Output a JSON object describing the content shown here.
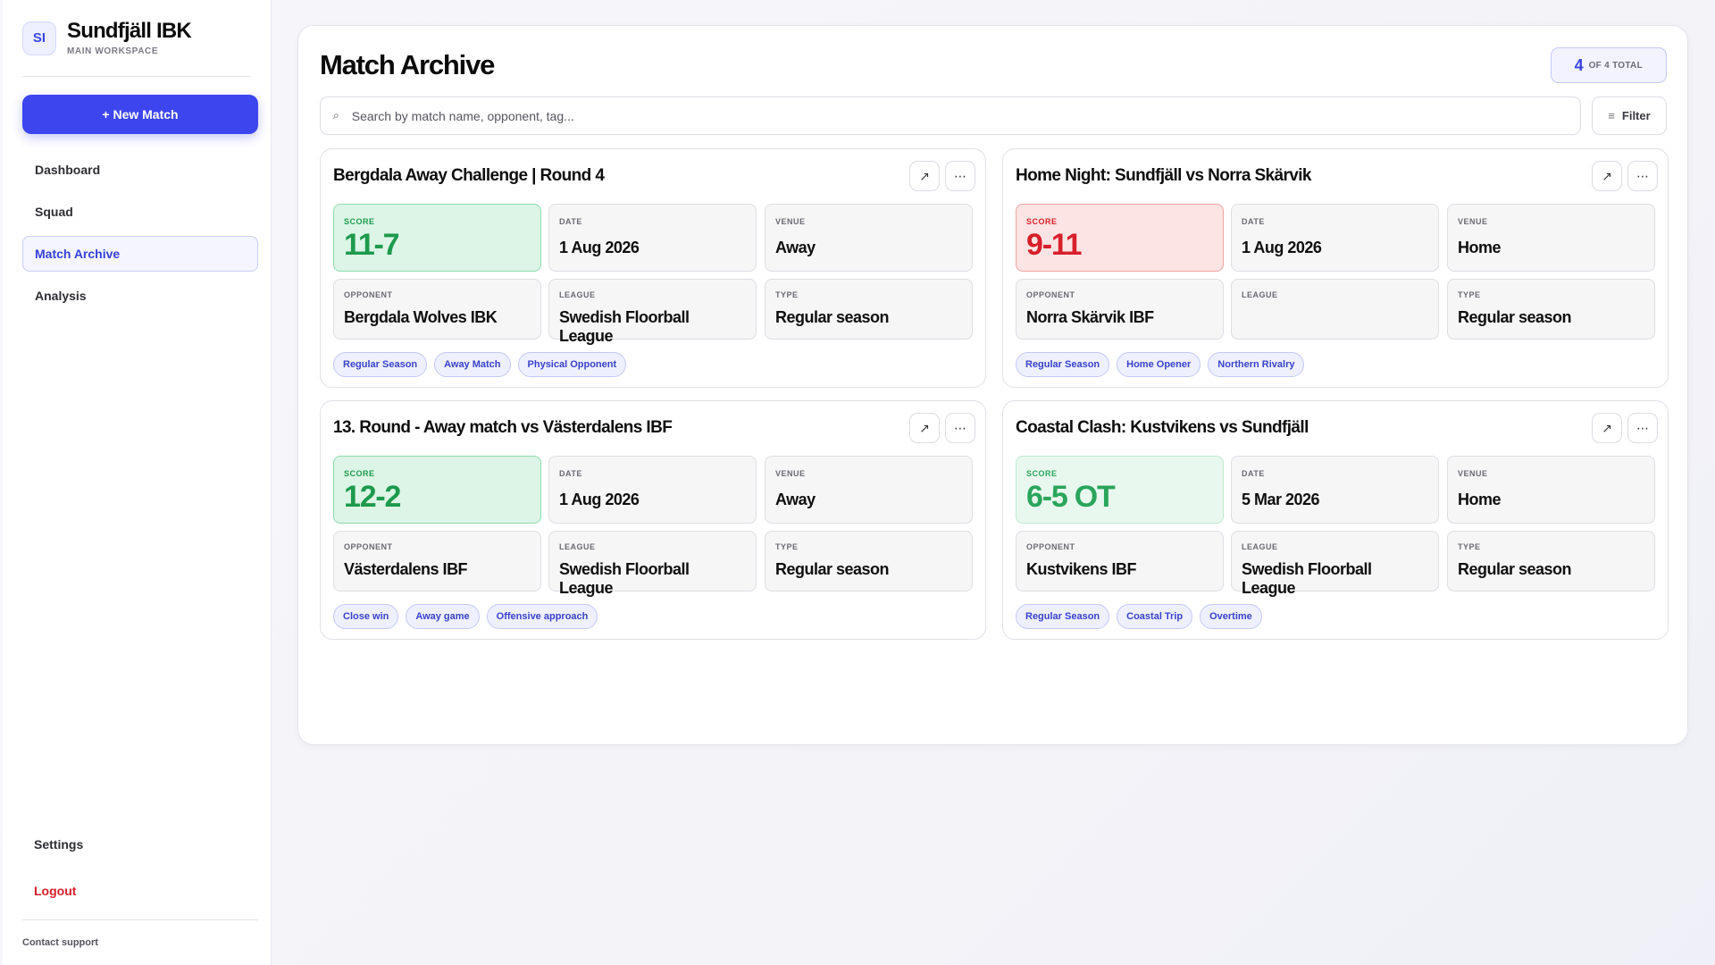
{
  "brand": {
    "initials": "SI",
    "name": "Sundfjäll IBK",
    "workspace": "MAIN WORKSPACE"
  },
  "new_match_label": "+ New Match",
  "nav": [
    {
      "label": "Dashboard",
      "active": false
    },
    {
      "label": "Squad",
      "active": false
    },
    {
      "label": "Match Archive",
      "active": true
    },
    {
      "label": "Analysis",
      "active": false
    }
  ],
  "settings_label": "Settings",
  "logout_label": "Logout",
  "contact_label": "Contact support",
  "page_title": "Match Archive",
  "count": {
    "value": "4",
    "label": "OF 4 TOTAL"
  },
  "search": {
    "placeholder": "Search by match name, opponent, tag..."
  },
  "filter_label": "Filter",
  "icons": {
    "open": "↗",
    "more": "⋯",
    "search": "⌕",
    "filter": "≡"
  },
  "labels": {
    "score": "SCORE",
    "date": "DATE",
    "venue": "VENUE",
    "opponent": "OPPONENT",
    "league": "LEAGUE",
    "type": "TYPE"
  },
  "colors": {
    "accent": "#3c45ee",
    "win": "#1d9a4d",
    "loss": "#d7202b",
    "logout": "#d71d2a"
  },
  "matches": [
    {
      "title": "Bergdala Away Challenge | Round 4",
      "score": "11-7",
      "result": "win",
      "date": "1 Aug 2026",
      "venue": "Away",
      "opponent": "Bergdala Wolves IBK",
      "league": "Swedish Floorball League",
      "type": "Regular season",
      "tags": [
        "Regular Season",
        "Away Match",
        "Physical Opponent"
      ]
    },
    {
      "title": "Home Night: Sundfjäll vs Norra Skärvik",
      "score": "9-11",
      "result": "loss",
      "date": "1 Aug 2026",
      "venue": "Home",
      "opponent": "Norra Skärvik IBF",
      "league": "",
      "type": "Regular season",
      "tags": [
        "Regular Season",
        "Home Opener",
        "Northern Rivalry"
      ]
    },
    {
      "title": "13. Round - Away match vs Västerdalens IBF",
      "score": "12-2",
      "result": "win",
      "date": "1 Aug 2026",
      "venue": "Away",
      "opponent": "Västerdalens IBF",
      "league": "Swedish Floorball League",
      "type": "Regular season",
      "tags": [
        "Close win",
        "Away game",
        "Offensive approach"
      ]
    },
    {
      "title": "Coastal Clash: Kustvikens vs Sundfjäll",
      "score": "6-5 OT",
      "result": "ot",
      "date": "5 Mar 2026",
      "venue": "Home",
      "opponent": "Kustvikens IBF",
      "league": "Swedish Floorball League",
      "type": "Regular season",
      "tags": [
        "Regular Season",
        "Coastal Trip",
        "Overtime"
      ]
    }
  ]
}
